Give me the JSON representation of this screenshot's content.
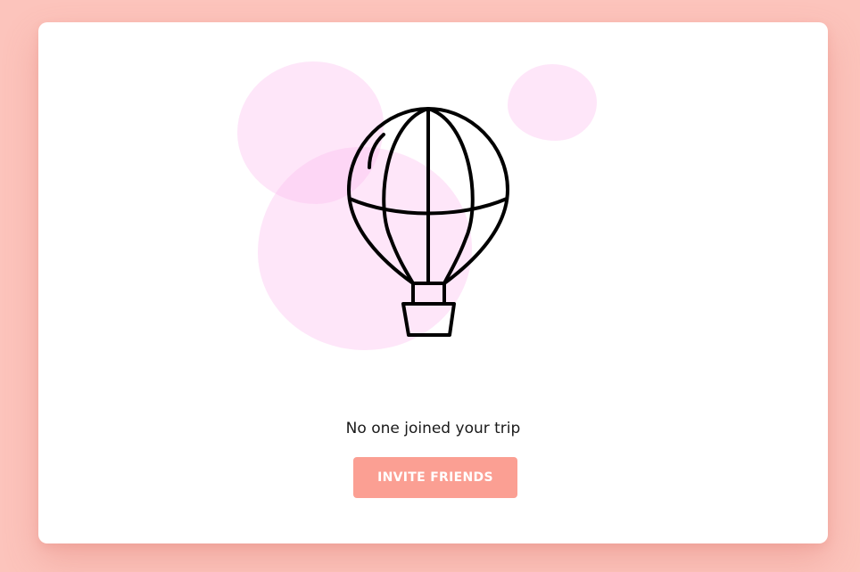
{
  "empty_state": {
    "message": "No one joined your trip",
    "illustration_icon": "hot-air-balloon-icon"
  },
  "actions": {
    "invite_label": "INVITE FRIENDS"
  },
  "colors": {
    "background": "#fcc4bc",
    "card": "#ffffff",
    "button": "#fb9f93",
    "blob": "#fdd8f5"
  }
}
